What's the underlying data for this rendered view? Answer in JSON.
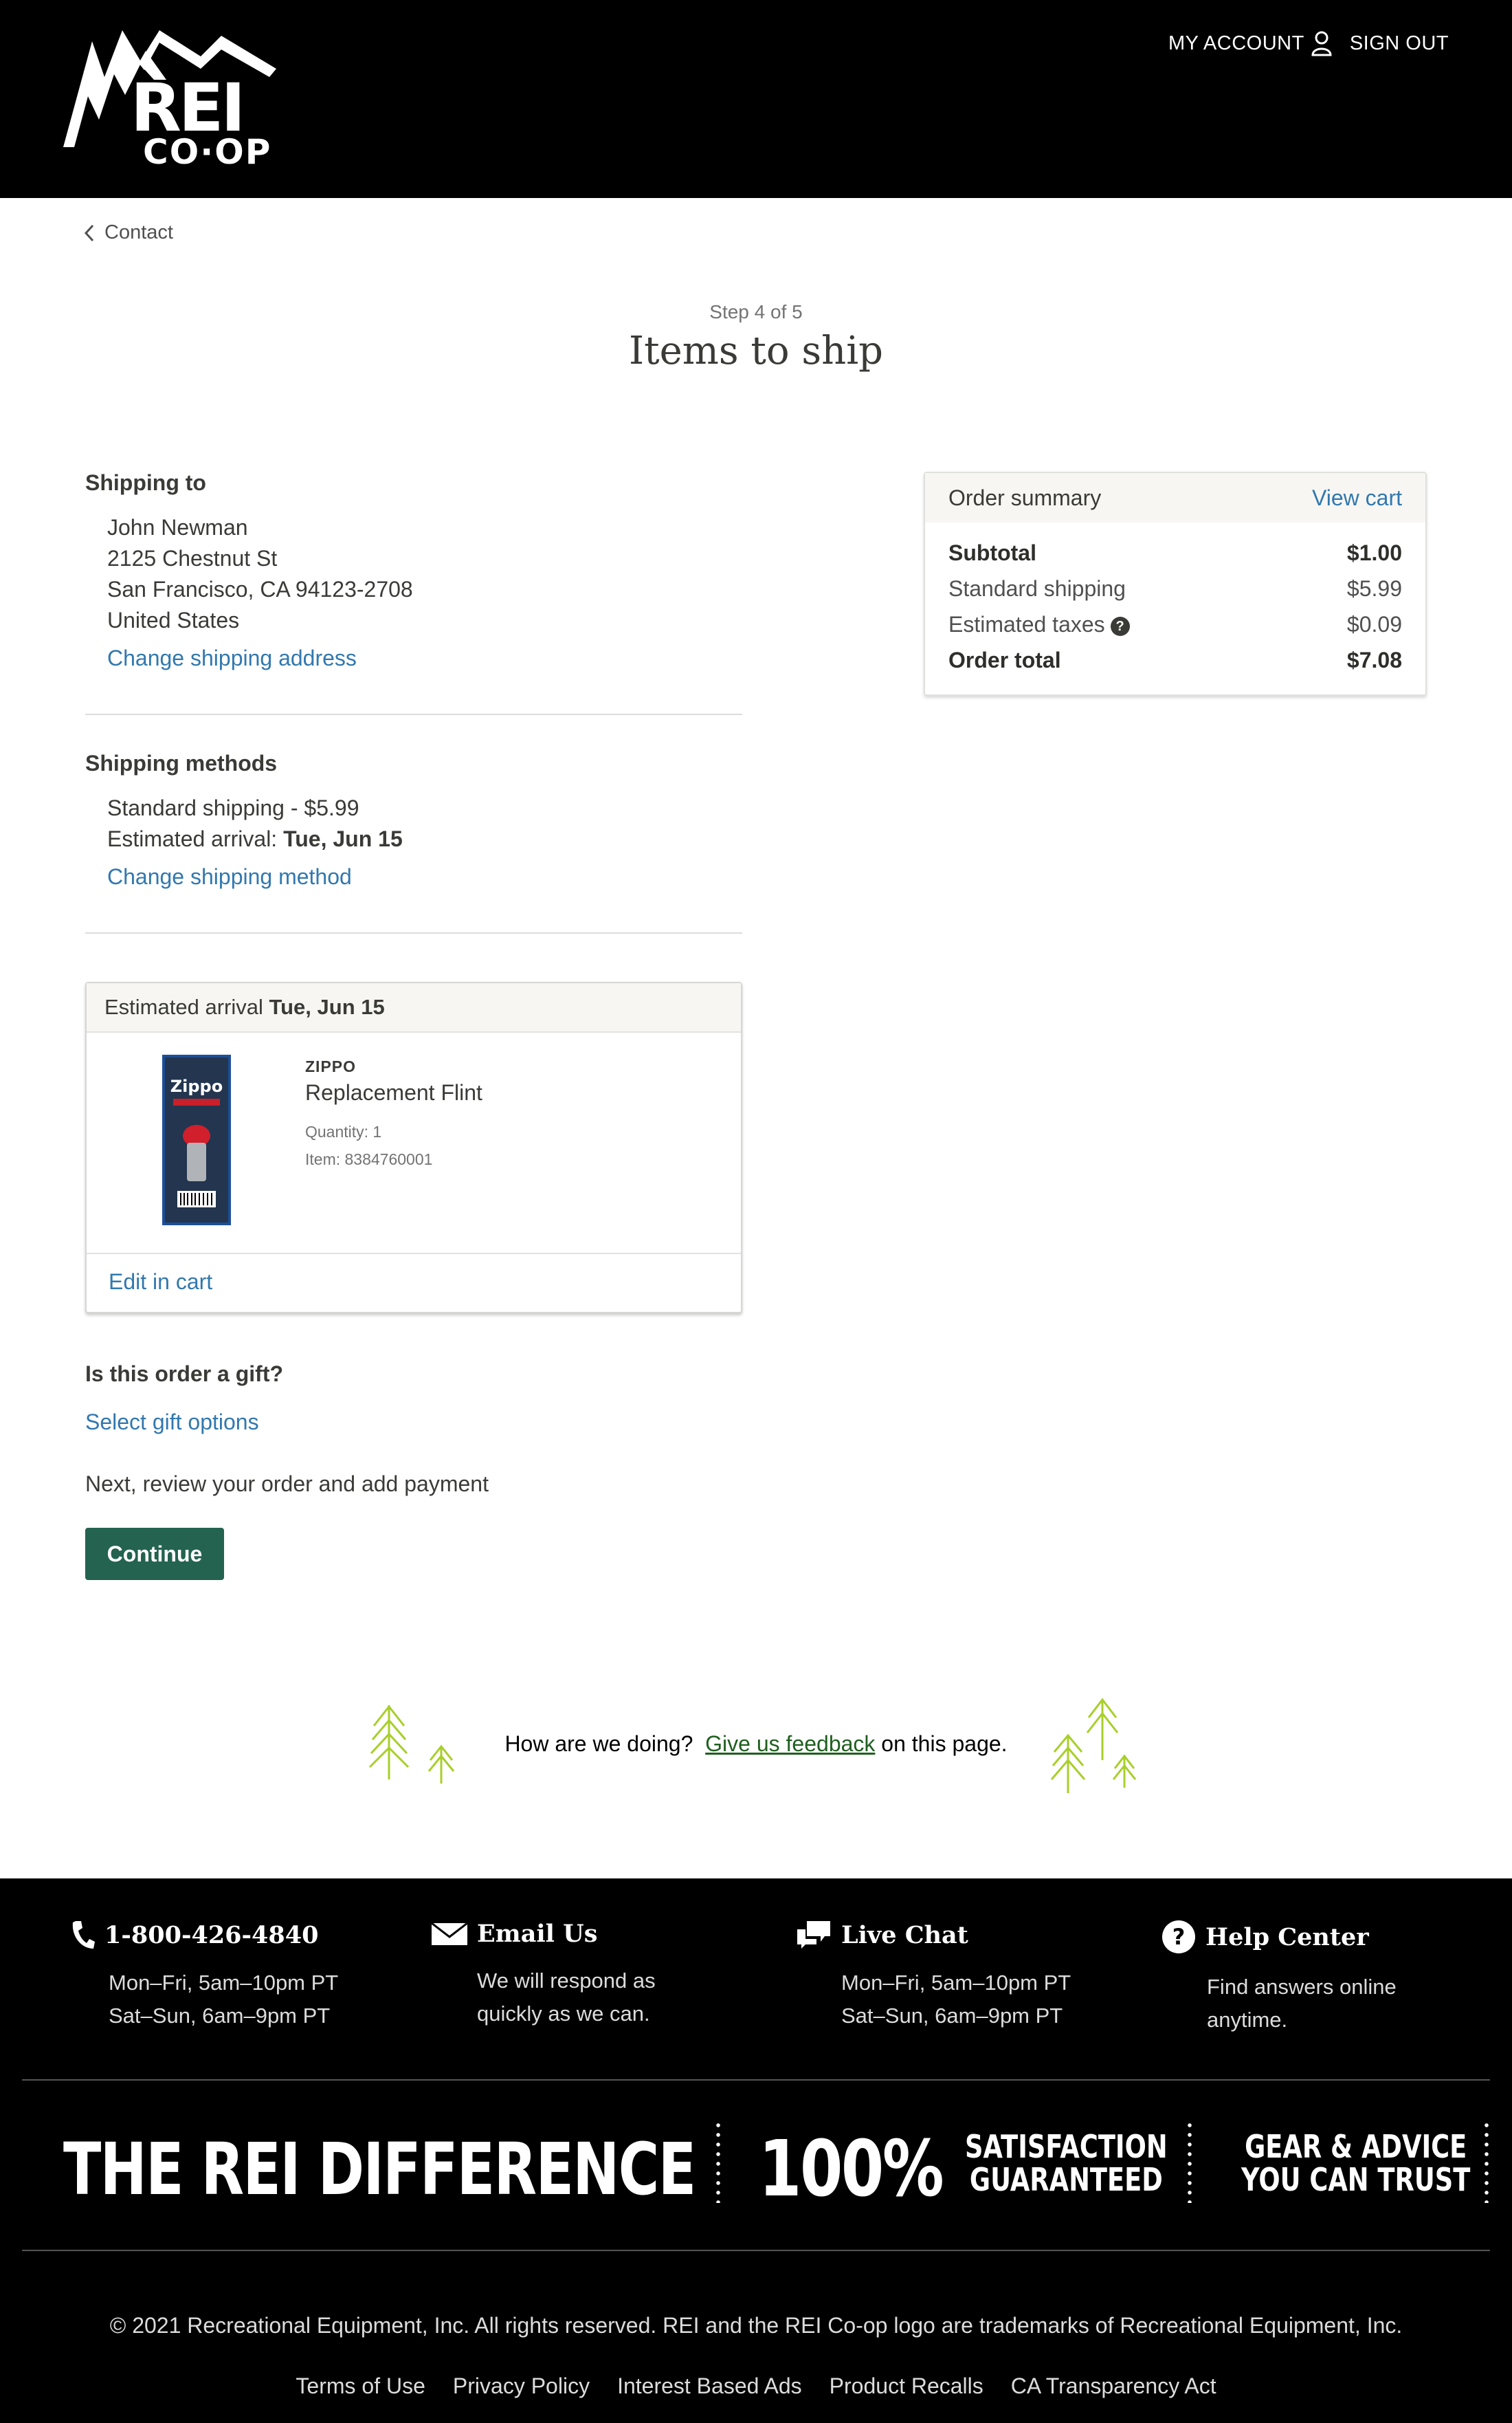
{
  "header": {
    "my_account": "MY ACCOUNT",
    "sign_out": "SIGN OUT",
    "logo_text_top": "REI",
    "logo_text_bottom": "CO·OP"
  },
  "back_link": "Contact",
  "step": "Step 4 of 5",
  "title": "Items to ship",
  "shipping_to": {
    "heading": "Shipping to",
    "address_lines": [
      "John Newman",
      "2125 Chestnut St",
      "San Francisco, CA 94123-2708",
      "United States"
    ],
    "change_link": "Change shipping address"
  },
  "shipping_methods": {
    "heading": "Shipping methods",
    "method": "Standard shipping - $5.99",
    "arrival_label": "Estimated arrival:",
    "arrival_date": "Tue, Jun 15",
    "change_link": "Change shipping method"
  },
  "shipment_card": {
    "header_label": "Estimated arrival",
    "header_date": "Tue, Jun 15",
    "product": {
      "brand": "ZIPPO",
      "name": "Replacement Flint",
      "quantity": "Quantity: 1",
      "item": "Item: 8384760001",
      "image_label": "Zippo"
    },
    "edit_link": "Edit in cart"
  },
  "gift": {
    "heading": "Is this order a gift?",
    "link": "Select gift options"
  },
  "next_text": "Next, review your order and add payment",
  "continue_button": "Continue",
  "order_summary": {
    "heading": "Order summary",
    "view_cart": "View cart",
    "rows": {
      "subtotal": {
        "label": "Subtotal",
        "value": "$1.00"
      },
      "shipping": {
        "label": "Standard shipping",
        "value": "$5.99"
      },
      "taxes": {
        "label": "Estimated taxes",
        "value": "$0.09"
      },
      "total": {
        "label": "Order total",
        "value": "$7.08"
      }
    }
  },
  "feedback": {
    "prefix": "How are we doing?",
    "link": "Give us feedback",
    "suffix": "on this page."
  },
  "footer": {
    "phone": {
      "title": "1-800-426-4840",
      "line1": "Mon–Fri, 5am–10pm PT",
      "line2": "Sat–Sun, 6am–9pm PT"
    },
    "email": {
      "title": "Email Us",
      "line1": "We will respond as",
      "line2": "quickly as we can."
    },
    "chat": {
      "title": "Live Chat",
      "line1": "Mon–Fri, 5am–10pm PT",
      "line2": "Sat–Sun, 6am–9pm PT"
    },
    "help": {
      "title": "Help Center",
      "line1": "Find answers online",
      "line2": "anytime."
    },
    "difference_title": "THE REI DIFFERENCE",
    "percent": "100%",
    "satisfaction_1": "SATISFACTION",
    "satisfaction_2": "GUARANTEED",
    "gear_1": "GEAR & ADVICE",
    "gear_2": "YOU CAN TRUST",
    "copyright": "© 2021 Recreational Equipment, Inc. All rights reserved. REI and the REI Co-op logo are trademarks of Recreational Equipment, Inc.",
    "links": [
      "Terms of Use",
      "Privacy Policy",
      "Interest Based Ads",
      "Product Recalls",
      "CA Transparency Act"
    ]
  },
  "colors": {
    "header_bg": "#000000",
    "link": "#3278ae",
    "continue_bg": "#23634f",
    "tree_green": "#a8cf2a"
  }
}
